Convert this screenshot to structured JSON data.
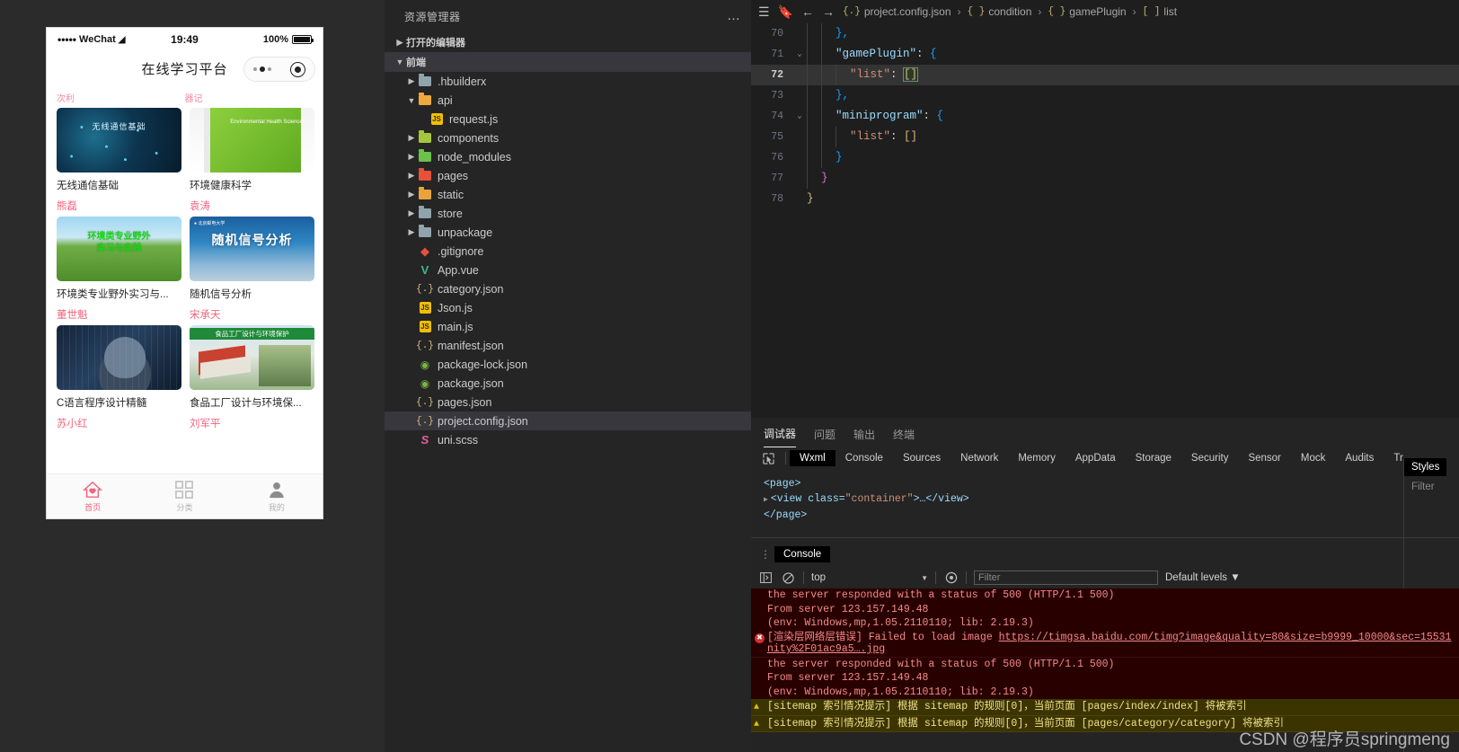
{
  "simulator": {
    "status": {
      "carrier": "WeChat",
      "dots": "•••••",
      "time": "19:49",
      "battery": "100%"
    },
    "navbar": {
      "title": "在线学习平台"
    },
    "section_labels": [
      "次利",
      "器记"
    ],
    "cards": [
      {
        "title": "无线通信基础",
        "author": "熊磊",
        "thumb_text": "无线通信基础"
      },
      {
        "title": "环境健康科学",
        "author": "袁涛",
        "thumb_text": "Environmental Health Science"
      },
      {
        "title": "环境类专业野外实习与...",
        "author": "董世魁",
        "thumb_text": "环境类专业野外\n实习与实践"
      },
      {
        "title": "随机信号分析",
        "author": "宋承天",
        "thumb_text": "随机信号分析"
      },
      {
        "title": "C语言程序设计精髓",
        "author": "苏小红",
        "thumb_text": ""
      },
      {
        "title": "食品工厂设计与环境保...",
        "author": "刘军平",
        "thumb_text": "食品工厂设计与环境保护"
      }
    ],
    "tabbar": [
      {
        "label": "首页",
        "icon": "home-icon",
        "active": true
      },
      {
        "label": "分类",
        "icon": "grid-icon",
        "active": false
      },
      {
        "label": "我的",
        "icon": "user-icon",
        "active": false
      }
    ]
  },
  "explorer": {
    "title": "资源管理器",
    "more_icon": "…",
    "sections": [
      {
        "label": "打开的编辑器",
        "expanded": false
      },
      {
        "label": "前端",
        "expanded": true
      }
    ],
    "tree": [
      {
        "label": ".hbuilderx",
        "type": "folder",
        "expanded": false,
        "indent": 1,
        "color": "#90a4ae"
      },
      {
        "label": "api",
        "type": "folder",
        "expanded": true,
        "indent": 1,
        "color": "#f0a93b"
      },
      {
        "label": "request.js",
        "type": "js",
        "indent": 2
      },
      {
        "label": "components",
        "type": "folder",
        "expanded": false,
        "indent": 1,
        "color": "#a4c639"
      },
      {
        "label": "node_modules",
        "type": "folder",
        "expanded": false,
        "indent": 1,
        "color": "#6cc24a"
      },
      {
        "label": "pages",
        "type": "folder",
        "expanded": false,
        "indent": 1,
        "color": "#e8503a"
      },
      {
        "label": "static",
        "type": "folder",
        "expanded": false,
        "indent": 1,
        "color": "#e8a33d"
      },
      {
        "label": "store",
        "type": "folder",
        "expanded": false,
        "indent": 1,
        "color": "#90a4ae"
      },
      {
        "label": "unpackage",
        "type": "folder",
        "expanded": false,
        "indent": 1,
        "color": "#90a4ae"
      },
      {
        "label": ".gitignore",
        "type": "git",
        "indent": 1
      },
      {
        "label": "App.vue",
        "type": "vue",
        "indent": 1
      },
      {
        "label": "category.json",
        "type": "json",
        "indent": 1
      },
      {
        "label": "Json.js",
        "type": "js",
        "indent": 1
      },
      {
        "label": "main.js",
        "type": "js",
        "indent": 1
      },
      {
        "label": "manifest.json",
        "type": "json",
        "indent": 1
      },
      {
        "label": "package-lock.json",
        "type": "npm",
        "indent": 1
      },
      {
        "label": "package.json",
        "type": "npm",
        "indent": 1
      },
      {
        "label": "pages.json",
        "type": "json",
        "indent": 1
      },
      {
        "label": "project.config.json",
        "type": "json",
        "indent": 1,
        "selected": true
      },
      {
        "label": "uni.scss",
        "type": "scss",
        "indent": 1
      }
    ]
  },
  "editor": {
    "breadcrumb": {
      "menu_icon": "hamburger-icon",
      "bookmark_icon": "bookmark-icon",
      "back_icon": "←",
      "forward_icon": "→",
      "segments": [
        {
          "sigil": "{.}",
          "label": "project.config.json"
        },
        {
          "sigil": "{ }",
          "label": "condition"
        },
        {
          "sigil": "{ }",
          "label": "gamePlugin"
        },
        {
          "sigil": "[ ]",
          "label": "list"
        }
      ],
      "separator": "›"
    },
    "lines": [
      {
        "num": "70",
        "fold": "",
        "indent": 2,
        "current": false,
        "tokens": [
          {
            "t": "},",
            "c": "k-br3"
          }
        ]
      },
      {
        "num": "71",
        "fold": "⌄",
        "indent": 2,
        "current": false,
        "tokens": [
          {
            "t": "\"gamePlugin\"",
            "c": "k-key"
          },
          {
            "t": ": ",
            "c": "k-pun"
          },
          {
            "t": "{",
            "c": "k-br3"
          }
        ]
      },
      {
        "num": "72",
        "fold": "",
        "indent": 3,
        "current": true,
        "tokens": [
          {
            "t": "\"list\"",
            "c": "k-str"
          },
          {
            "t": ": ",
            "c": "k-pun"
          },
          {
            "t": "[]",
            "c": "k-br sel-box"
          }
        ]
      },
      {
        "num": "73",
        "fold": "",
        "indent": 2,
        "current": false,
        "tokens": [
          {
            "t": "},",
            "c": "k-br3"
          }
        ]
      },
      {
        "num": "74",
        "fold": "⌄",
        "indent": 2,
        "current": false,
        "tokens": [
          {
            "t": "\"miniprogram\"",
            "c": "k-key"
          },
          {
            "t": ": ",
            "c": "k-pun"
          },
          {
            "t": "{",
            "c": "k-br3"
          }
        ]
      },
      {
        "num": "75",
        "fold": "",
        "indent": 3,
        "current": false,
        "tokens": [
          {
            "t": "\"list\"",
            "c": "k-str"
          },
          {
            "t": ": ",
            "c": "k-pun"
          },
          {
            "t": "[]",
            "c": "k-br"
          }
        ]
      },
      {
        "num": "76",
        "fold": "",
        "indent": 2,
        "current": false,
        "tokens": [
          {
            "t": "}",
            "c": "k-br3"
          }
        ]
      },
      {
        "num": "77",
        "fold": "",
        "indent": 1,
        "current": false,
        "tokens": [
          {
            "t": "}",
            "c": "k-br2"
          }
        ]
      },
      {
        "num": "78",
        "fold": "",
        "indent": 0,
        "current": false,
        "tokens": [
          {
            "t": "}",
            "c": "k-br"
          }
        ]
      }
    ]
  },
  "devtools": {
    "panel_tabs": [
      {
        "label": "调试器",
        "active": true
      },
      {
        "label": "问题",
        "active": false
      },
      {
        "label": "输出",
        "active": false
      },
      {
        "label": "终端",
        "active": false
      }
    ],
    "inspect_icon": "inspect-cursor-icon",
    "tabs": [
      {
        "label": "Wxml",
        "active": true
      },
      {
        "label": "Console",
        "active": false
      },
      {
        "label": "Sources",
        "active": false
      },
      {
        "label": "Network",
        "active": false
      },
      {
        "label": "Memory",
        "active": false
      },
      {
        "label": "AppData",
        "active": false
      },
      {
        "label": "Storage",
        "active": false
      },
      {
        "label": "Security",
        "active": false
      },
      {
        "label": "Sensor",
        "active": false
      },
      {
        "label": "Mock",
        "active": false
      },
      {
        "label": "Audits",
        "active": false
      },
      {
        "label": "Tr",
        "active": false
      }
    ],
    "dom": {
      "line1": "<page>",
      "line2_open": "<view class=",
      "line2_val": "\"container\"",
      "line2_close": ">…</view>",
      "line3": "</page>"
    },
    "styles": {
      "tab": "Styles",
      "filter": "Filter"
    },
    "console": {
      "tab": "Console",
      "context": "top",
      "filter_placeholder": "Filter",
      "levels": "Default levels",
      "entries": [
        {
          "type": "error-cont",
          "text": "the server responded with a status of 500 (HTTP/1.1 500)"
        },
        {
          "type": "error-cont",
          "text": "From server 123.157.149.48"
        },
        {
          "type": "error-cont",
          "text": "(env: Windows,mp,1.05.2110110; lib: 2.19.3)"
        },
        {
          "type": "error",
          "prefix": "[渲染层网络层错误] Failed to load image ",
          "link": "https://timgsa.baidu.com/timg?image&quality=80&size=b9999_10000&sec=15531",
          "link2": "nity%2F01ac9a5….jpg"
        },
        {
          "type": "error-cont",
          "text": "the server responded with a status of 500 (HTTP/1.1 500)"
        },
        {
          "type": "error-cont",
          "text": "From server 123.157.149.48"
        },
        {
          "type": "error-cont",
          "text": "(env: Windows,mp,1.05.2110110; lib: 2.19.3)"
        },
        {
          "type": "warn",
          "text": "[sitemap 索引情况提示] 根据 sitemap 的规则[0]，当前页面 [pages/index/index] 将被索引"
        },
        {
          "type": "warn",
          "text": "[sitemap 索引情况提示] 根据 sitemap 的规则[0]，当前页面 [pages/category/category] 将被索引"
        }
      ]
    }
  },
  "watermark": "CSDN @程序员springmeng",
  "colors": {
    "accent_pink": "#f0647e",
    "editor_bg": "#1e1e1e",
    "sidebar_bg": "#252526",
    "error_bg": "#290000",
    "warn_bg": "#3b3400"
  }
}
